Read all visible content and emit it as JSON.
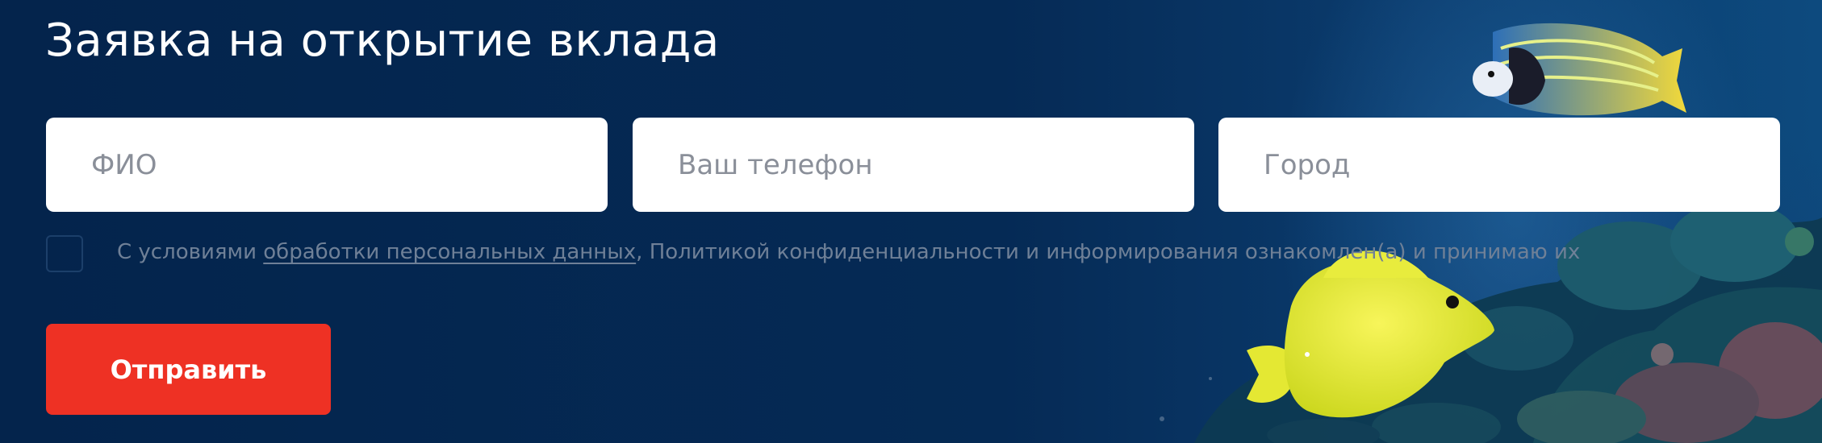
{
  "form": {
    "title": "Заявка на открытие вклада",
    "fields": {
      "name_placeholder": "ФИО",
      "phone_placeholder": "Ваш телефон",
      "city_placeholder": "Город"
    },
    "consent": {
      "prefix": "С условиями ",
      "link": "обработки персональных данных",
      "suffix": ", Политикой конфиденциальности и информирования ознакомлен(а) и принимаю их"
    },
    "submit_label": "Отправить"
  },
  "colors": {
    "background": "#04244c",
    "accent": "#ee3124"
  }
}
